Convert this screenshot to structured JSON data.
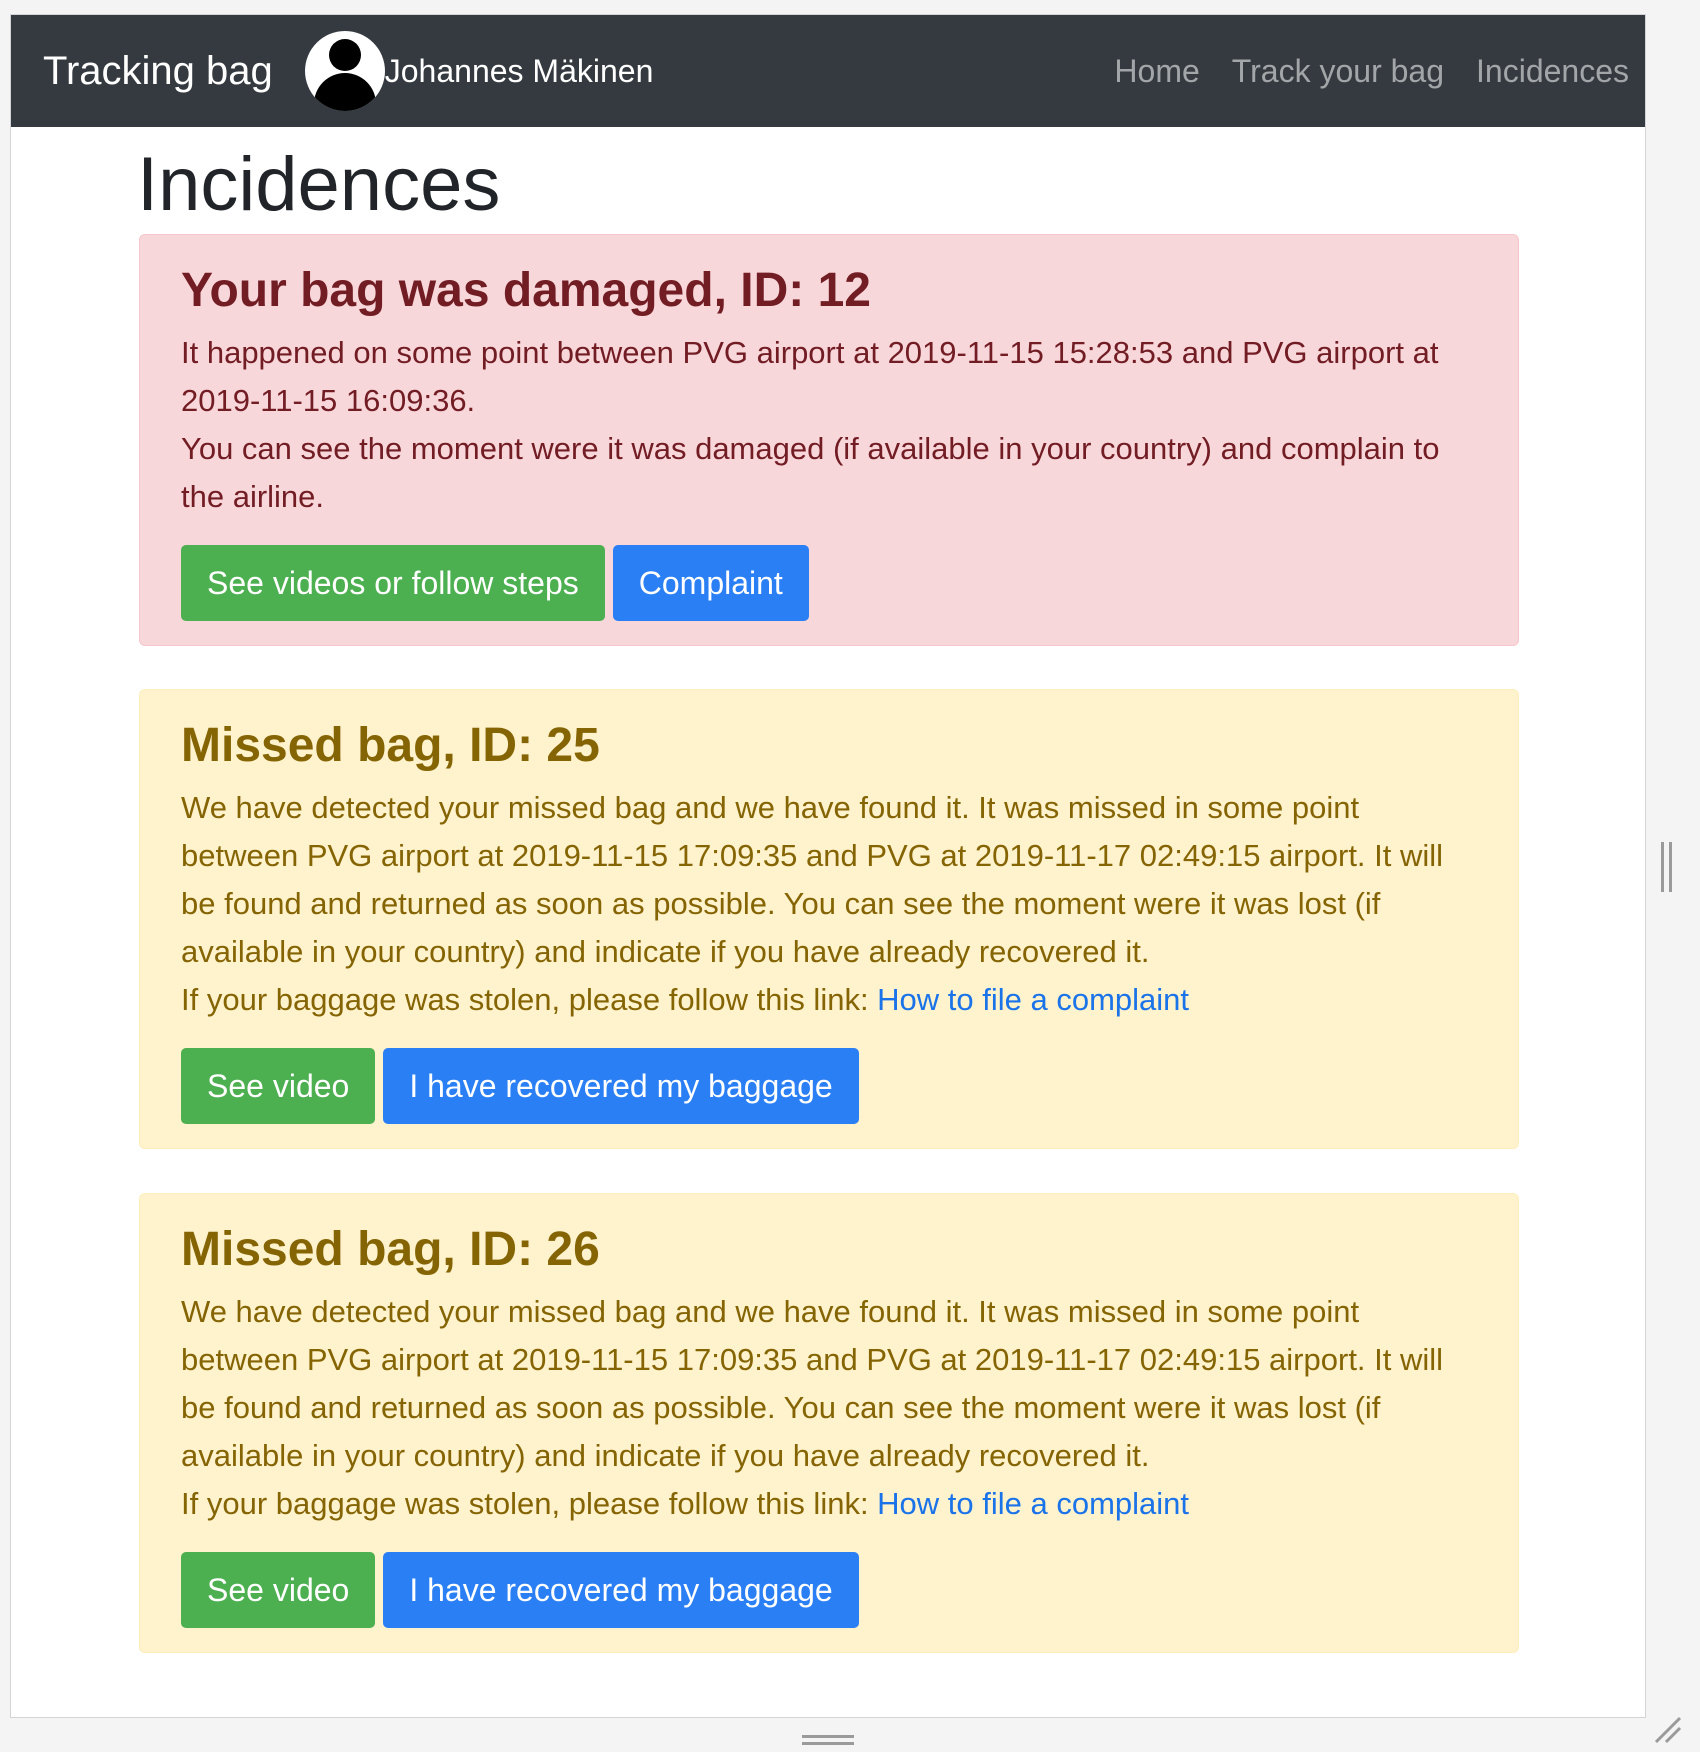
{
  "navbar": {
    "brand": "Tracking bag",
    "user_name": "Johannes Mäkinen",
    "links": [
      "Home",
      "Track your bag",
      "Incidences"
    ]
  },
  "page": {
    "title": "Incidences"
  },
  "incidences": [
    {
      "title": "Your bag was damaged, ID: 12",
      "line1": "It happened on some point between PVG airport at 2019-11-15 15:28:53 and PVG airport at 2019-11-15 16:09:36.",
      "line2": "You can see the moment were it was damaged (if available in your country) and complain to the airline.",
      "btn1": "See videos or follow steps",
      "btn2": "Complaint"
    },
    {
      "title": "Missed bag, ID: 25",
      "line1": "We have detected your missed bag and we have found it. It was missed in some point between PVG airport at 2019-11-15 17:09:35 and PVG at 2019-11-17 02:49:15 airport. It will be found and returned as soon as possible. You can see the moment were it was lost (if available in your country) and indicate if you have already recovered it.",
      "line2": "If your baggage was stolen, please follow this link: ",
      "link": "How to file a complaint",
      "btn1": "See video",
      "btn2": "I have recovered my baggage"
    },
    {
      "title": "Missed bag, ID: 26",
      "line1": "We have detected your missed bag and we have found it. It was missed in some point between PVG airport at 2019-11-15 17:09:35 and PVG at 2019-11-17 02:49:15 airport. It will be found and returned as soon as possible. You can see the moment were it was lost (if available in your country) and indicate if you have already recovered it.",
      "line2": "If your baggage was stolen, please follow this link: ",
      "link": "How to file a complaint",
      "btn1": "See video",
      "btn2": "I have recovered my baggage"
    }
  ],
  "colors": {
    "navbar_bg": "#343a40",
    "danger_bg": "#f8d7da",
    "danger_text": "#721c24",
    "warning_bg": "#fff3cd",
    "warning_text": "#856404",
    "success_button": "#4caf50",
    "primary_button": "#2a7ff5",
    "link": "#1a73e8"
  }
}
